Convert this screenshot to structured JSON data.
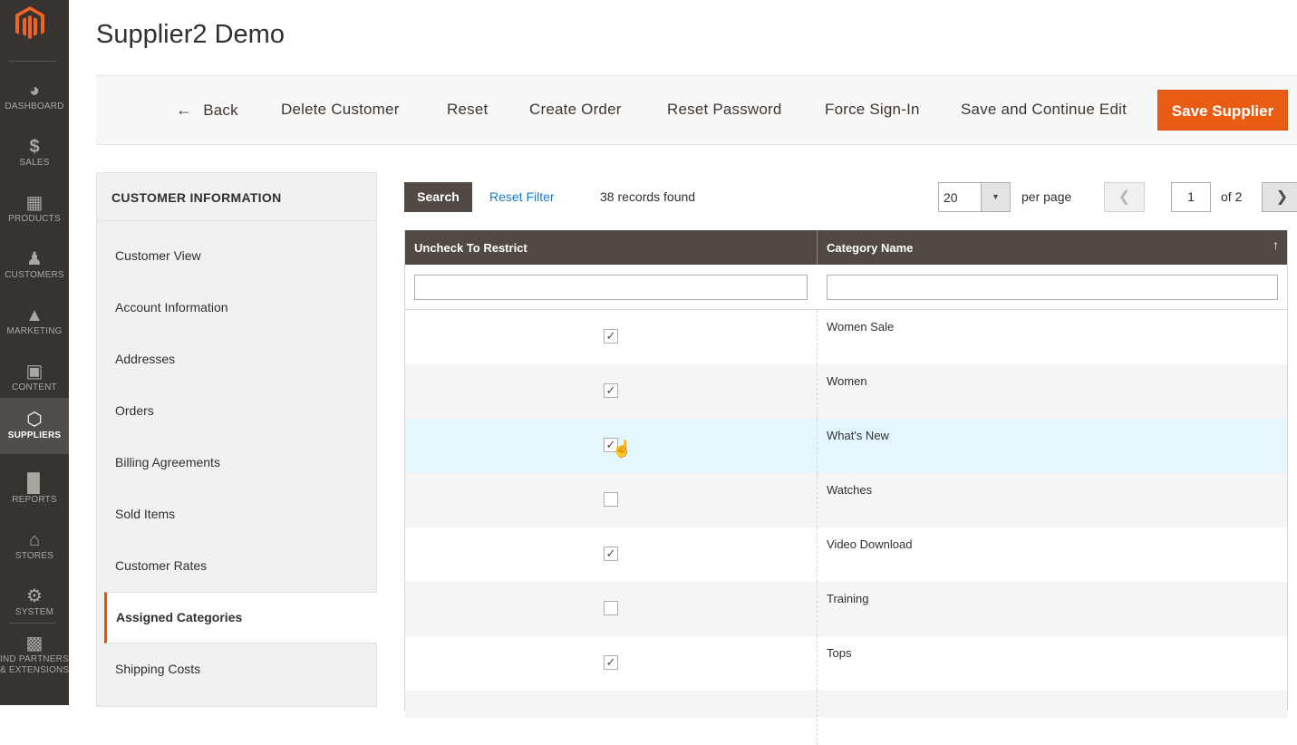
{
  "nav": {
    "items": [
      {
        "label": "DASHBOARD",
        "icon": "dashboard-icon"
      },
      {
        "label": "SALES",
        "icon": "dollar-icon"
      },
      {
        "label": "PRODUCTS",
        "icon": "box-icon"
      },
      {
        "label": "CUSTOMERS",
        "icon": "person-icon"
      },
      {
        "label": "MARKETING",
        "icon": "megaphone-icon"
      },
      {
        "label": "CONTENT",
        "icon": "layout-icon"
      },
      {
        "label": "SUPPLIERS",
        "icon": "hexagon-icon"
      },
      {
        "label": "REPORTS",
        "icon": "bar-chart-icon"
      },
      {
        "label": "STORES",
        "icon": "store-icon"
      },
      {
        "label": "SYSTEM",
        "icon": "gear-icon"
      },
      {
        "label": "IND PARTNERS",
        "label2": "& EXTENSIONS",
        "icon": "blocks-icon"
      }
    ]
  },
  "page": {
    "title": "Supplier2 Demo"
  },
  "toolbar": {
    "back": "Back",
    "delete_customer": "Delete Customer",
    "reset": "Reset",
    "create_order": "Create Order",
    "reset_password": "Reset Password",
    "force_sign_in": "Force Sign-In",
    "save_continue": "Save and Continue Edit",
    "save_supplier": "Save Supplier"
  },
  "sidebar": {
    "title": "CUSTOMER INFORMATION",
    "items": [
      "Customer View",
      "Account Information",
      "Addresses",
      "Orders",
      "Billing Agreements",
      "Sold Items",
      "Customer Rates",
      "Assigned Categories",
      "Shipping Costs"
    ],
    "active": "Assigned Categories"
  },
  "grid_controls": {
    "search": "Search",
    "reset_filter": "Reset Filter",
    "records_found": "38 records found",
    "per_page_value": "20",
    "per_page_label": "per page",
    "current_page": "1",
    "of_pages": "of 2"
  },
  "grid": {
    "columns": [
      "Uncheck To Restrict",
      "Category Name"
    ],
    "rows": [
      {
        "checked": true,
        "name": "Women Sale"
      },
      {
        "checked": true,
        "name": "Women"
      },
      {
        "checked": true,
        "name": "What's New"
      },
      {
        "checked": false,
        "name": "Watches"
      },
      {
        "checked": true,
        "name": "Video Download"
      },
      {
        "checked": false,
        "name": "Training"
      },
      {
        "checked": true,
        "name": "Tops"
      }
    ]
  },
  "colors": {
    "brand_orange": "#eb5202",
    "nav_bg": "#373330",
    "grid_header": "#514943",
    "link": "#1979c3"
  }
}
